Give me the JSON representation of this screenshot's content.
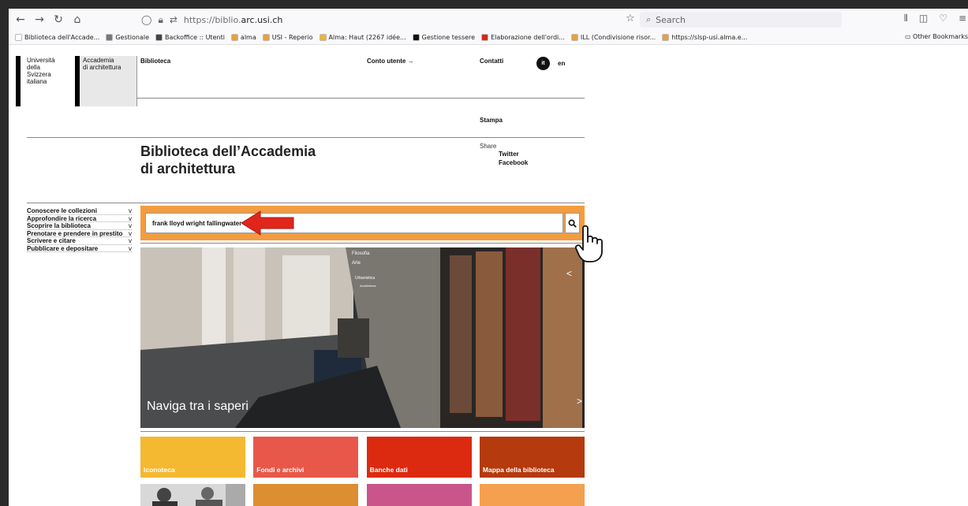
{
  "browser": {
    "url_prefix": "https://biblio.",
    "url_domain": "arc.usi.ch",
    "search_placeholder": "Search",
    "bookmarks": [
      {
        "label": "Biblioteca dell'Accade...",
        "color": "#ffffff"
      },
      {
        "label": "Gestionale",
        "color": "#777777"
      },
      {
        "label": "Backoffice :: Utenti",
        "color": "#444444"
      },
      {
        "label": "alma",
        "color": "#e8a13c"
      },
      {
        "label": "USI - Reperio",
        "color": "#e8a13c"
      },
      {
        "label": "Alma: Haut (2267 idée...",
        "color": "#f0b42a"
      },
      {
        "label": "Gestione tessere",
        "color": "#111111"
      },
      {
        "label": "Elaborazione dell'ordi...",
        "color": "#d9281c"
      },
      {
        "label": "ILL (Condivisione risor...",
        "color": "#e8a13c"
      },
      {
        "label": "https://slsp-usi.alma.e...",
        "color": "#e8a13c"
      }
    ],
    "other_bookmarks": "Other Bookmarks"
  },
  "header": {
    "university": [
      "Università",
      "della",
      "Svizzera",
      "italiana"
    ],
    "academy": [
      "Accademia",
      "di architettura"
    ],
    "biblioteca": "Biblioteca",
    "conto_utente": "Conto utente →",
    "contatti": "Contatti",
    "lang_it": "it",
    "lang_en": "en",
    "stampa": "Stampa"
  },
  "title_line1": "Biblioteca dell’Accademia",
  "title_line2": "di architettura",
  "share": {
    "label": "Share",
    "twitter": "Twitter",
    "facebook": "Facebook"
  },
  "menu": [
    {
      "label": "Conoscere le collezioni",
      "chevron": "v"
    },
    {
      "label": "Approfondire la ricerca",
      "chevron": "v"
    },
    {
      "label": "Scoprire la biblioteca",
      "chevron": "v"
    },
    {
      "label": "Prenotare e prendere in prestito",
      "chevron": "v"
    },
    {
      "label": "Scrivere e citare",
      "chevron": "v"
    },
    {
      "label": "Pubblicare e depositare",
      "chevron": "v"
    }
  ],
  "search": {
    "value": "frank lloyd wright fallingwater"
  },
  "hero": {
    "caption": "Naviga tra i saperi",
    "labels": [
      "Filosofia",
      "Arte",
      "Urbanistica",
      "Architettura"
    ]
  },
  "tiles": [
    {
      "label": "Iconoteca",
      "color": "#f4b930"
    },
    {
      "label": "Fondi e archivi",
      "color": "#e8584a"
    },
    {
      "label": "Banche dati",
      "color": "#dc2a10"
    },
    {
      "label": "Mappa della biblioteca",
      "color": "#b53a0e"
    }
  ],
  "tiles_row2": [
    {
      "color": "#777777"
    },
    {
      "color": "#dc8e30"
    },
    {
      "color": "#c9558a"
    },
    {
      "color": "#f5a04e"
    }
  ],
  "colors": {
    "search_bg": "#f39c41",
    "annotation_arrow": "#e0261b"
  }
}
